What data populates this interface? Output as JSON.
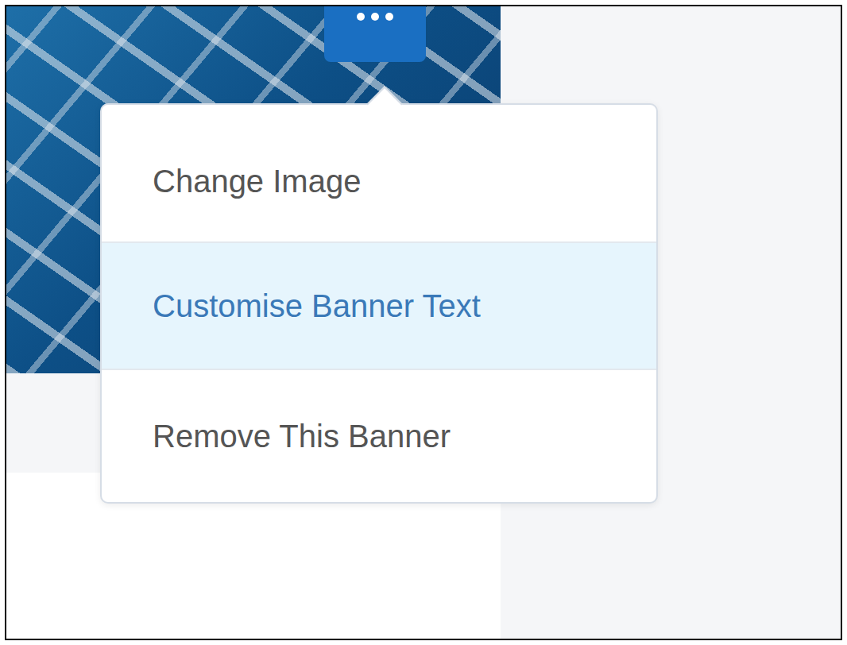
{
  "banner": {
    "menu_open": true
  },
  "menu": {
    "items": [
      {
        "label": "Change Image",
        "selected": false
      },
      {
        "label": "Customise Banner Text",
        "selected": true
      },
      {
        "label": "Remove This Banner",
        "selected": false
      }
    ]
  }
}
